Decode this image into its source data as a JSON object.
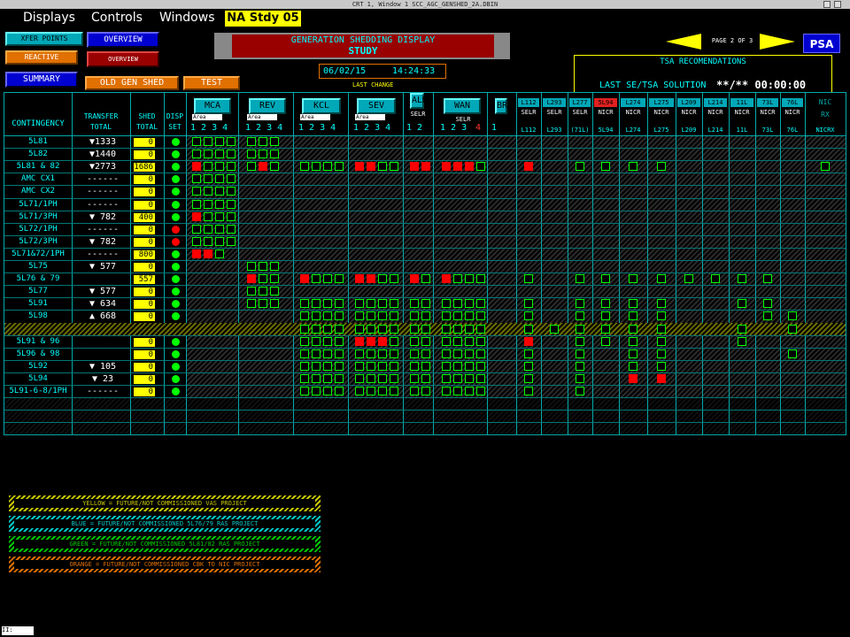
{
  "window_title": "CRT 1, Window 1        SCC_AGC_GENSHED_2A.DBIN",
  "menu": [
    "Displays",
    "Controls",
    "Windows"
  ],
  "study_tag": "NA  Stdy 05",
  "nav_buttons": {
    "xfer_points": "XFER POINTS",
    "overview1": "OVERVIEW",
    "reactive": "REACTIVE",
    "overview2": "OVERVIEW",
    "summary": "SUMMARY",
    "old_gen_shed": "OLD GEN SHED",
    "test": "TEST"
  },
  "banner": {
    "line1": "GENERATION SHEDDING DISPLAY",
    "line2": "STUDY"
  },
  "date": "06/02/15",
  "time": "14:24:33",
  "last_change": "LAST CHANGE",
  "page": "PAGE 2 OF 3",
  "psa": "PSA",
  "tsa": {
    "title": "TSA RECOMENDATIONS",
    "label": "LAST SE/TSA SOLUTION",
    "value": "**/** 00:00:00"
  },
  "headers": {
    "contingency": "CONTINGENCY",
    "transfer_total": [
      "TRANSFER",
      "TOTAL"
    ],
    "shed_total": [
      "SHED",
      "TOTAL"
    ],
    "disp_set": [
      "DISP",
      "SET"
    ]
  },
  "groups": [
    {
      "label": "MCA",
      "sub": "Area",
      "nums": "1 2 3 4"
    },
    {
      "label": "REV",
      "sub": "Area",
      "nums": "1 2 3 4"
    },
    {
      "label": "KCL",
      "sub": "Area",
      "nums": "1 2 3 4"
    },
    {
      "label": "SEV",
      "sub": "Area",
      "nums": "1 2 3 4"
    },
    {
      "label": "ALH",
      "sub": "SELR",
      "nums": "1 2"
    },
    {
      "label": "WAN",
      "sub": "SELR",
      "nums": "1 2 3"
    },
    {
      "label": "BRX",
      "sub": "",
      "nums": "1"
    }
  ],
  "wan_extra": "4",
  "lines": [
    {
      "top": "L112",
      "mid": "SELR",
      "bot": "L112",
      "red": false
    },
    {
      "top": "L293",
      "mid": "SELR",
      "bot": "L293",
      "red": false
    },
    {
      "top": "L277",
      "mid": "SELR",
      "bot": "(71L)",
      "red": false
    },
    {
      "top": "5L94",
      "mid": "NICR",
      "bot": "5L94",
      "red": true
    },
    {
      "top": "L274",
      "mid": "NICR",
      "bot": "L274",
      "red": false
    },
    {
      "top": "L275",
      "mid": "NICR",
      "bot": "L275",
      "red": false
    },
    {
      "top": "L209",
      "mid": "NICR",
      "bot": "L209",
      "red": false
    },
    {
      "top": "L214",
      "mid": "NICR",
      "bot": "L214",
      "red": false
    },
    {
      "top": "11L",
      "mid": "NICR",
      "bot": "11L",
      "red": false
    },
    {
      "top": "73L",
      "mid": "NICR",
      "bot": "73L",
      "red": false
    },
    {
      "top": "76L",
      "mid": "NICR",
      "bot": "76L",
      "red": false
    },
    {
      "top": "NIC",
      "mid": "RX",
      "bot": "NICRX",
      "red": false
    }
  ],
  "rows": [
    {
      "name": "5L81",
      "xfer": "▼1333",
      "shed": "0",
      "dot": "green"
    },
    {
      "name": "5L82",
      "xfer": "▼1440",
      "shed": "0",
      "dot": "green"
    },
    {
      "name": "5L81 & 82",
      "xfer": "▼2773",
      "shed": "1686",
      "dot": "green"
    },
    {
      "name": "AMC CX1",
      "xfer": "------",
      "shed": "0",
      "dot": "green"
    },
    {
      "name": "AMC CX2",
      "xfer": "------",
      "shed": "0",
      "dot": "green"
    },
    {
      "name": "5L71/1PH",
      "xfer": "------",
      "shed": "0",
      "dot": "green"
    },
    {
      "name": "5L71/3PH",
      "xfer": "▼ 782",
      "shed": "400",
      "dot": "green"
    },
    {
      "name": "5L72/1PH",
      "xfer": "------",
      "shed": "0",
      "dot": "red"
    },
    {
      "name": "5L72/3PH",
      "xfer": "▼ 782",
      "shed": "0",
      "dot": "red"
    },
    {
      "name": "5L71&72/1PH",
      "xfer": "------",
      "shed": "800",
      "dot": "green"
    },
    {
      "name": "5L75",
      "xfer": "▼ 577",
      "shed": "0",
      "dot": "green"
    },
    {
      "name": "5L76 & 79",
      "xfer": "",
      "shed": "557",
      "dot": "green"
    },
    {
      "name": "5L77",
      "xfer": "▼ 577",
      "shed": "0",
      "dot": "green"
    },
    {
      "name": "5L91",
      "xfer": "▼ 634",
      "shed": "0",
      "dot": "green"
    },
    {
      "name": "5L98",
      "xfer": "▲ 668",
      "shed": "0",
      "dot": "green"
    },
    {
      "name": "5L96",
      "xfer": "",
      "shed": "0",
      "dot": "green"
    },
    {
      "name": "5L91 & 96",
      "xfer": "",
      "shed": "0",
      "dot": "green"
    },
    {
      "name": "5L96 & 98",
      "xfer": "",
      "shed": "0",
      "dot": "green"
    },
    {
      "name": "5L92",
      "xfer": "▼ 105",
      "shed": "0",
      "dot": "green"
    },
    {
      "name": "5L94",
      "xfer": "▼ 23",
      "shed": "0",
      "dot": "green"
    },
    {
      "name": "5L91-6-8/1PH",
      "xfer": "------",
      "shed": "0",
      "dot": "green"
    }
  ],
  "legend": [
    {
      "text": "YELLOW = FUTURE/NOT COMMISSIONED VAS PROJECT",
      "color": "#c8c800"
    },
    {
      "text": "BLUE = FUTURE/NOT COMMISSIONED 5L76/79 RAS PROJECT",
      "color": "#00c8c8"
    },
    {
      "text": "GREEN = FUTURE/NOT COMMISSIONED 5L81/82 RAS PROJECT",
      "color": "#00c800"
    },
    {
      "text": "ORANGE = FUTURE/NOT COMMISSIONED CBK TO NIC PROJECT",
      "color": "#e07000"
    }
  ],
  "status_box": "II:"
}
